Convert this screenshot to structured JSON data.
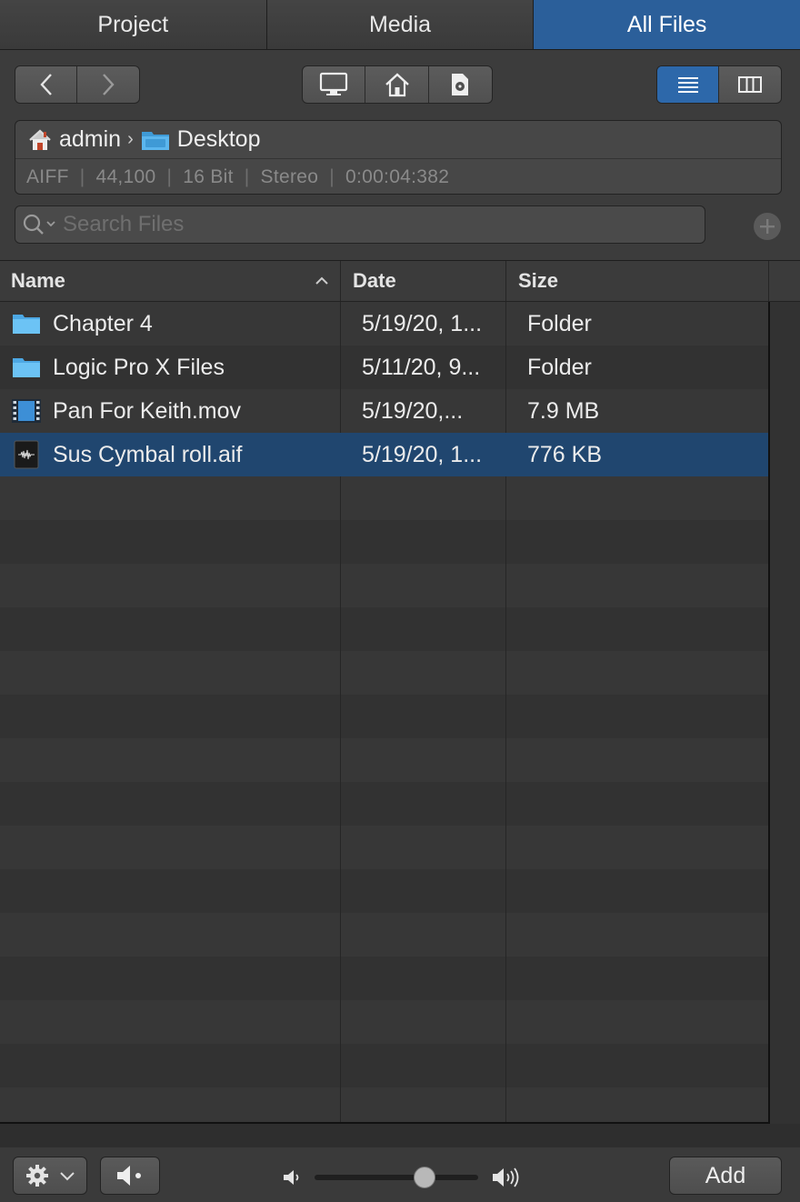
{
  "tabs": [
    {
      "label": "Project",
      "active": false
    },
    {
      "label": "Media",
      "active": false
    },
    {
      "label": "All Files",
      "active": true
    }
  ],
  "path": {
    "user": "admin",
    "folder": "Desktop"
  },
  "file_info": {
    "format": "AIFF",
    "sample_rate": "44,100",
    "bit_depth": "16 Bit",
    "channels": "Stereo",
    "duration": "0:00:04:382"
  },
  "search": {
    "placeholder": "Search Files"
  },
  "table": {
    "columns": {
      "name": "Name",
      "date": "Date",
      "size": "Size"
    },
    "sort": {
      "column": "name",
      "direction": "ascending"
    },
    "rows": [
      {
        "icon": "folder-icon",
        "name": "Chapter 4",
        "date": "5/19/20, 1...",
        "size": "Folder",
        "selected": false
      },
      {
        "icon": "folder-icon",
        "name": "Logic Pro X Files",
        "date": "5/11/20, 9...",
        "size": "Folder",
        "selected": false
      },
      {
        "icon": "movie-file-icon",
        "name": "Pan For Keith.mov",
        "date": "5/19/20,...",
        "size": "7.9 MB",
        "selected": false
      },
      {
        "icon": "audio-file-icon",
        "name": "Sus Cymbal roll.aif",
        "date": "5/19/20, 1...",
        "size": "776 KB",
        "selected": true
      }
    ]
  },
  "toolbar": {
    "view_mode": "list"
  },
  "bottom": {
    "add_label": "Add",
    "volume": 0.67
  },
  "colors": {
    "accent": "#2b5f9a",
    "selection": "#20466f",
    "background": "#323232"
  }
}
